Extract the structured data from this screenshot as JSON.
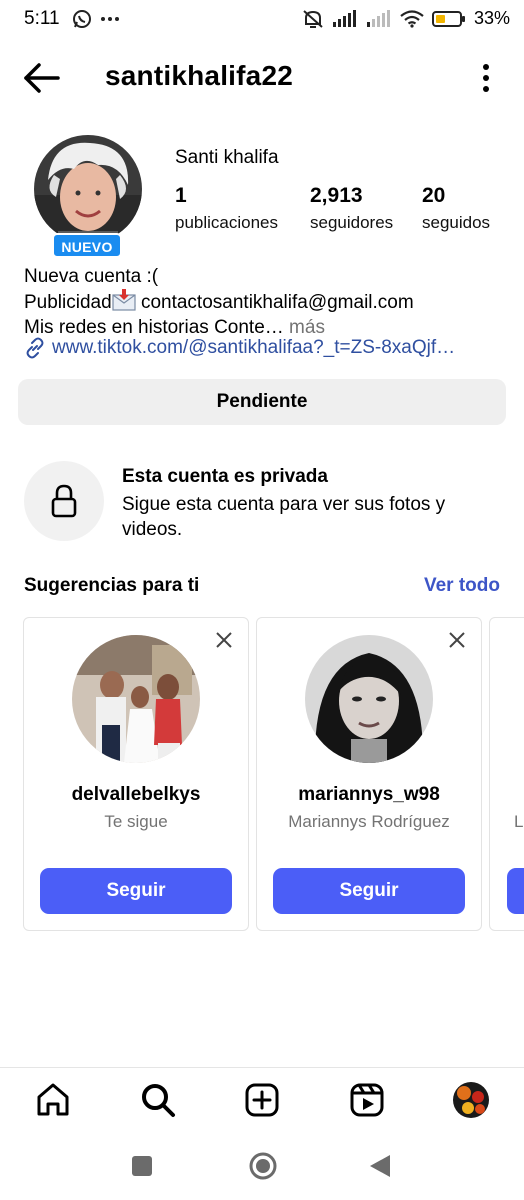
{
  "status_bar": {
    "time": "5:11",
    "app_icons": [
      "whatsapp-icon",
      "more-dots-icon"
    ],
    "indicators": [
      "mute-icon",
      "signal-icon",
      "signal-icon",
      "wifi-icon",
      "battery-icon"
    ],
    "battery_text": "33%"
  },
  "header": {
    "username": "santikhalifa22",
    "back_icon": "arrow-left-icon",
    "menu_icon": "kebab-menu-icon"
  },
  "profile": {
    "badge": "NUEVO",
    "full_name": "Santi khalifa",
    "stats": [
      {
        "value": "1",
        "label": "publicaciones"
      },
      {
        "value": "2,913",
        "label": "seguidores"
      },
      {
        "value": "20",
        "label": "seguidos"
      }
    ],
    "bio": {
      "line1": "Nueva cuenta :(",
      "line2_prefix": "Publicidad",
      "line2_email": " contactosantikhalifa@gmail.com",
      "line3": "Mis redes en historias Conte…",
      "more": " más",
      "link": "www.tiktok.com/@santikhalifaa?_t=ZS-8xaQjf…"
    },
    "follow_state_button": "Pendiente"
  },
  "private_notice": {
    "title": "Esta cuenta es privada",
    "description": "Sigue esta cuenta para ver sus fotos y videos."
  },
  "suggestions": {
    "title": "Sugerencias para ti",
    "see_all": "Ver todo",
    "cards": [
      {
        "username": "delvallebelkys",
        "subtitle": "Te sigue",
        "button": "Seguir"
      },
      {
        "username": "mariannys_w98",
        "subtitle": "Mariannys Rodríguez",
        "button": "Seguir"
      },
      {
        "subtitle_partial": "L"
      }
    ]
  },
  "bottom_nav": {
    "items": [
      "home-icon",
      "search-icon",
      "create-icon",
      "reels-icon",
      "profile-avatar"
    ]
  },
  "colors": {
    "accent_blue": "#4b5ef7",
    "link_blue": "#2f4fa0",
    "badge_blue": "#1a8cf0",
    "muted_text": "#737373",
    "button_gray": "#efefef"
  }
}
